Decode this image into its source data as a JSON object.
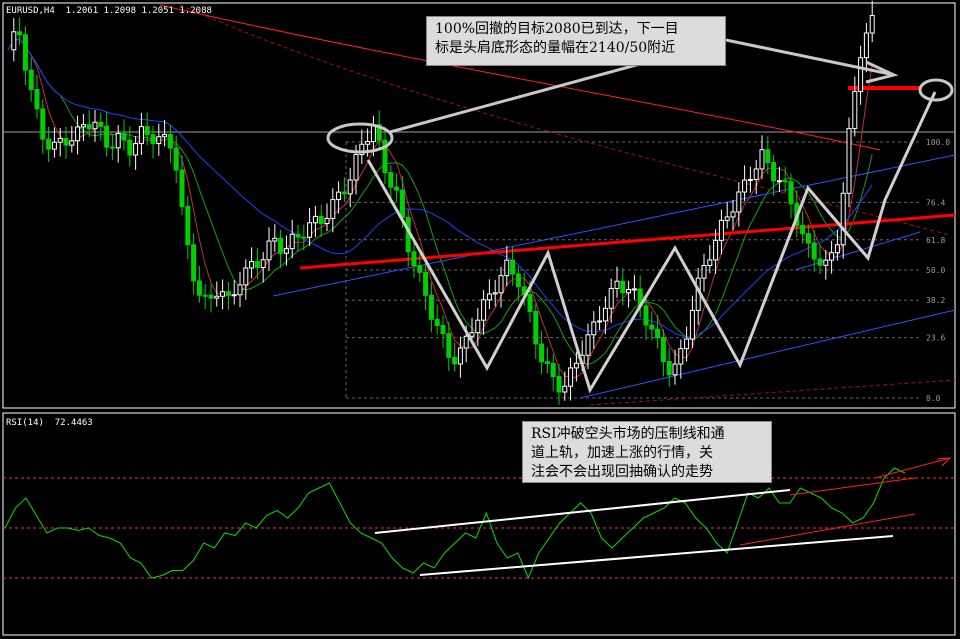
{
  "header": {
    "main": "EURUSD,H4  1.2061 1.2098 1.2051 1.2088",
    "rsi": "RSI(14)  72.4463"
  },
  "annotations": {
    "top_note": "100%回撤的目标2080已到达，下一目\n标是头肩底形态的量幅在2140/50附近",
    "rsi_note": "RSI冲破空头市场的压制线和通\n道上轨，加速上涨的行情，关\n注会不会出现回抽确认的走势"
  },
  "colors": {
    "background": "#000000",
    "bull_candle": "#ffffff",
    "bear_candle": "#00d000",
    "ma_red": "#ff2020",
    "ma_blue": "#2040ff",
    "ma_green": "#10a010",
    "rsi_line": "#00e000",
    "neckline": "#ff0000",
    "pattern_zigzag": "#d0d0d0"
  },
  "chart_data": {
    "type": "line",
    "title": "",
    "instrument": "EURUSD",
    "timeframe": "H4",
    "ohlc_last": {
      "open": 1.2061,
      "high": 1.2098,
      "low": 1.2051,
      "close": 1.2088
    },
    "fibonacci_levels": [
      "100.0",
      "76.4",
      "61.8",
      "50.0",
      "38.2",
      "23.6",
      "0.0"
    ],
    "fib_values": [
      100,
      76.4,
      61.8,
      50.0,
      38.2,
      23.6,
      0
    ],
    "price_path": [
      0.92,
      0.96,
      0.8,
      0.7,
      0.66,
      0.7,
      0.68,
      0.72,
      0.7,
      0.66,
      0.69,
      0.67,
      0.7,
      0.68,
      0.66,
      0.65,
      0.42,
      0.3,
      0.24,
      0.28,
      0.22,
      0.3,
      0.34,
      0.38,
      0.42,
      0.38,
      0.4,
      0.43,
      0.46,
      0.5,
      0.55,
      0.58,
      0.66,
      0.7,
      0.6,
      0.55,
      0.42,
      0.32,
      0.22,
      0.14,
      0.08,
      0.12,
      0.2,
      0.24,
      0.28,
      0.32,
      0.3,
      0.22,
      0.12,
      0.05,
      0.0,
      0.04,
      0.12,
      0.18,
      0.26,
      0.3,
      0.28,
      0.22,
      0.16,
      0.1,
      0.06,
      0.14,
      0.26,
      0.34,
      0.4,
      0.48,
      0.54,
      0.6,
      0.64,
      0.58,
      0.54,
      0.48,
      0.4,
      0.38,
      0.34,
      0.42,
      0.7,
      0.92,
      1.0
    ],
    "rsi": {
      "period": 14,
      "last": 72.4463,
      "levels": [
        70,
        50,
        30
      ],
      "values": [
        50,
        58,
        62,
        55,
        48,
        50,
        50,
        49,
        50,
        47,
        46,
        44,
        38,
        36,
        30,
        31,
        33,
        33,
        37,
        44,
        42,
        48,
        47,
        52,
        50,
        55,
        57,
        54,
        58,
        64,
        66,
        68,
        60,
        52,
        48,
        46,
        44,
        38,
        34,
        32,
        36,
        34,
        40,
        44,
        48,
        46,
        56,
        44,
        38,
        40,
        30,
        40,
        46,
        52,
        56,
        60,
        56,
        46,
        42,
        46,
        50,
        54,
        56,
        58,
        62,
        60,
        54,
        50,
        44,
        40,
        52,
        64,
        62,
        66,
        60,
        60,
        66,
        64,
        62,
        58,
        56,
        52,
        54,
        60,
        70,
        74,
        72
      ]
    }
  }
}
